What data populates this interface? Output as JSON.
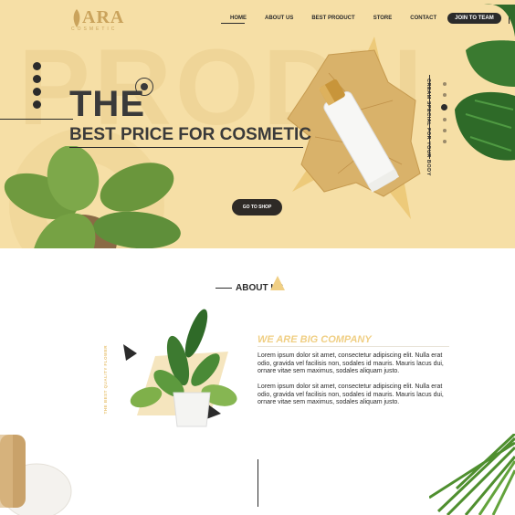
{
  "brand": {
    "name": "ARA",
    "tagline": "COSMETIC"
  },
  "nav": {
    "items": [
      "HOME",
      "ABOUT US",
      "BEST PRODUCT",
      "STORE",
      "CONTACT"
    ],
    "join_label": "JOIN TO TEAM",
    "close_label": "X"
  },
  "hero": {
    "background_word": "PRODU",
    "headline": "THE",
    "subheadline": "BEST PRICE FOR COSMETIC",
    "cta_label": "GO TO SHOP",
    "side_text": "CREAM SPECIAL FOR YOUR BODY",
    "slider_dots": 6,
    "active_dot": 3
  },
  "social_icons": [
    "snapchat-icon",
    "facebook-icon",
    "instagram-icon",
    "youtube-icon"
  ],
  "about": {
    "title": "ABOUT US",
    "vertical_label": "THE BEST QUALITY FLOWER",
    "company_title": "WE ARE BIG COMPANY",
    "paragraphs": [
      "Lorem ipsum dolor sit amet, consectetur adipiscing elit. Nulla erat odio, gravida vel facilisis non, sodales id mauris. Mauris lacus dui, ornare vitae sem maximus, sodales aliquam justo.",
      "Lorem ipsum dolor sit amet, consectetur adipiscing elit. Nulla erat odio, gravida vel facilisis non, sodales id mauris. Mauris lacus dui, ornare vitae sem maximus, sodales aliquam justo."
    ]
  },
  "colors": {
    "hero_bg": "#f6dfa6",
    "accent": "#f0cf84",
    "dark": "#2b2b2b",
    "tube_cap": "#c8953a",
    "leaf": "#5f8f3a"
  }
}
